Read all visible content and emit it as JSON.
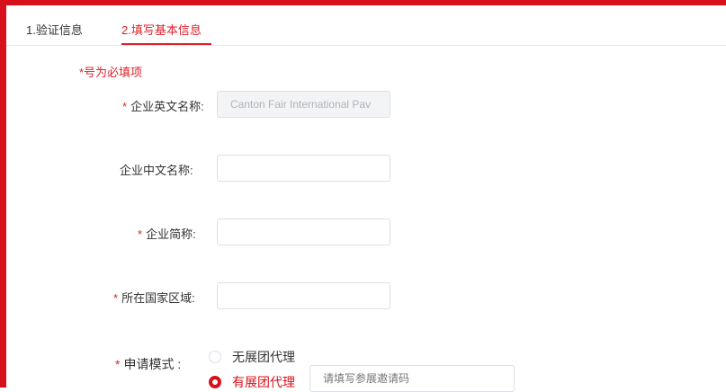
{
  "tabs": [
    {
      "label": "1.验证信息"
    },
    {
      "label": "2.填写基本信息"
    }
  ],
  "required_note": "*号为必填项",
  "fields": {
    "english_name": {
      "label": "企业英文名称:",
      "value": "Canton Fair International Pav"
    },
    "chinese_name": {
      "label": "企业中文名称:",
      "value": ""
    },
    "short_name": {
      "label": "企业简称:",
      "value": ""
    },
    "country_region": {
      "label": "所在国家区域:",
      "value": ""
    }
  },
  "apply_mode": {
    "label": "申请模式 :",
    "options": [
      {
        "label": "无展团代理",
        "checked": false
      },
      {
        "label": "有展团代理",
        "checked": true
      }
    ],
    "invite_code_placeholder": "请填写参展邀请码"
  },
  "required_marker": "*",
  "colors": {
    "accent": "#d8101c",
    "tab_active": "#e0202a"
  }
}
